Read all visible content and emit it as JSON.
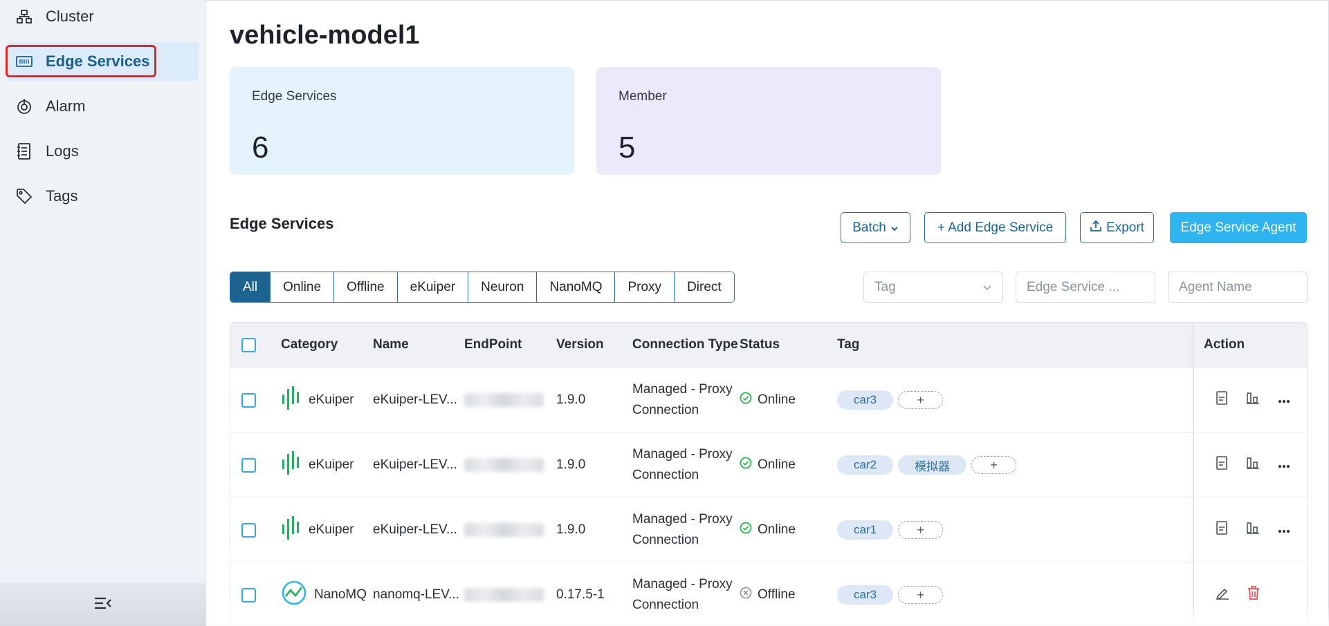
{
  "sidebar": {
    "items": [
      {
        "label": "Cluster",
        "icon": "cluster-icon"
      },
      {
        "label": "Edge Services",
        "icon": "edge-services-icon"
      },
      {
        "label": "Alarm",
        "icon": "alarm-icon"
      },
      {
        "label": "Logs",
        "icon": "logs-icon"
      },
      {
        "label": "Tags",
        "icon": "tag-icon"
      }
    ],
    "active_item": "Edge Services",
    "collapse_icon": "collapse-menu-icon"
  },
  "page": {
    "title": "vehicle-model1"
  },
  "stats": {
    "edge_services": {
      "label": "Edge Services",
      "value": "6"
    },
    "member": {
      "label": "Member",
      "value": "5"
    }
  },
  "section": {
    "title": "Edge Services"
  },
  "toolbar": {
    "batch_label": "Batch",
    "add_label": "+ Add Edge Service",
    "export_label": "Export",
    "agent_label": "Edge Service Agent"
  },
  "filters": {
    "segments": [
      "All",
      "Online",
      "Offline",
      "eKuiper",
      "Neuron",
      "NanoMQ",
      "Proxy",
      "Direct"
    ],
    "active": "All",
    "tag_placeholder": "Tag",
    "service_placeholder": "Edge Service ...",
    "agent_placeholder": "Agent Name"
  },
  "table": {
    "columns": [
      "Category",
      "Name",
      "EndPoint",
      "Version",
      "Connection Type",
      "Status",
      "Tag",
      "Action"
    ],
    "rows": [
      {
        "category": "eKuiper",
        "name": "eKuiper-LEV...",
        "version": "1.9.0",
        "connection": [
          "Managed - Proxy",
          "Connection"
        ],
        "status": "Online",
        "tags": [
          "car3"
        ]
      },
      {
        "category": "eKuiper",
        "name": "eKuiper-LEV...",
        "version": "1.9.0",
        "connection": [
          "Managed - Proxy",
          "Connection"
        ],
        "status": "Online",
        "tags": [
          "car2",
          "模拟器"
        ]
      },
      {
        "category": "eKuiper",
        "name": "eKuiper-LEV...",
        "version": "1.9.0",
        "connection": [
          "Managed - Proxy",
          "Connection"
        ],
        "status": "Online",
        "tags": [
          "car1"
        ]
      },
      {
        "category": "NanoMQ",
        "name": "nanomq-LEV...",
        "version": "0.17.5-1",
        "connection": [
          "Managed - Proxy",
          "Connection"
        ],
        "status": "Offline",
        "tags": [
          "car3"
        ]
      }
    ],
    "tag_add_label": "+"
  },
  "colors": {
    "accent": "#1d638f",
    "primary_button": "#2eb5f0",
    "online": "#2bb24c",
    "offline": "#8a9099",
    "ekuiper_green": "#22b05a",
    "nanomq_blue": "#2eb5f0",
    "delete_red": "#e5484d"
  }
}
